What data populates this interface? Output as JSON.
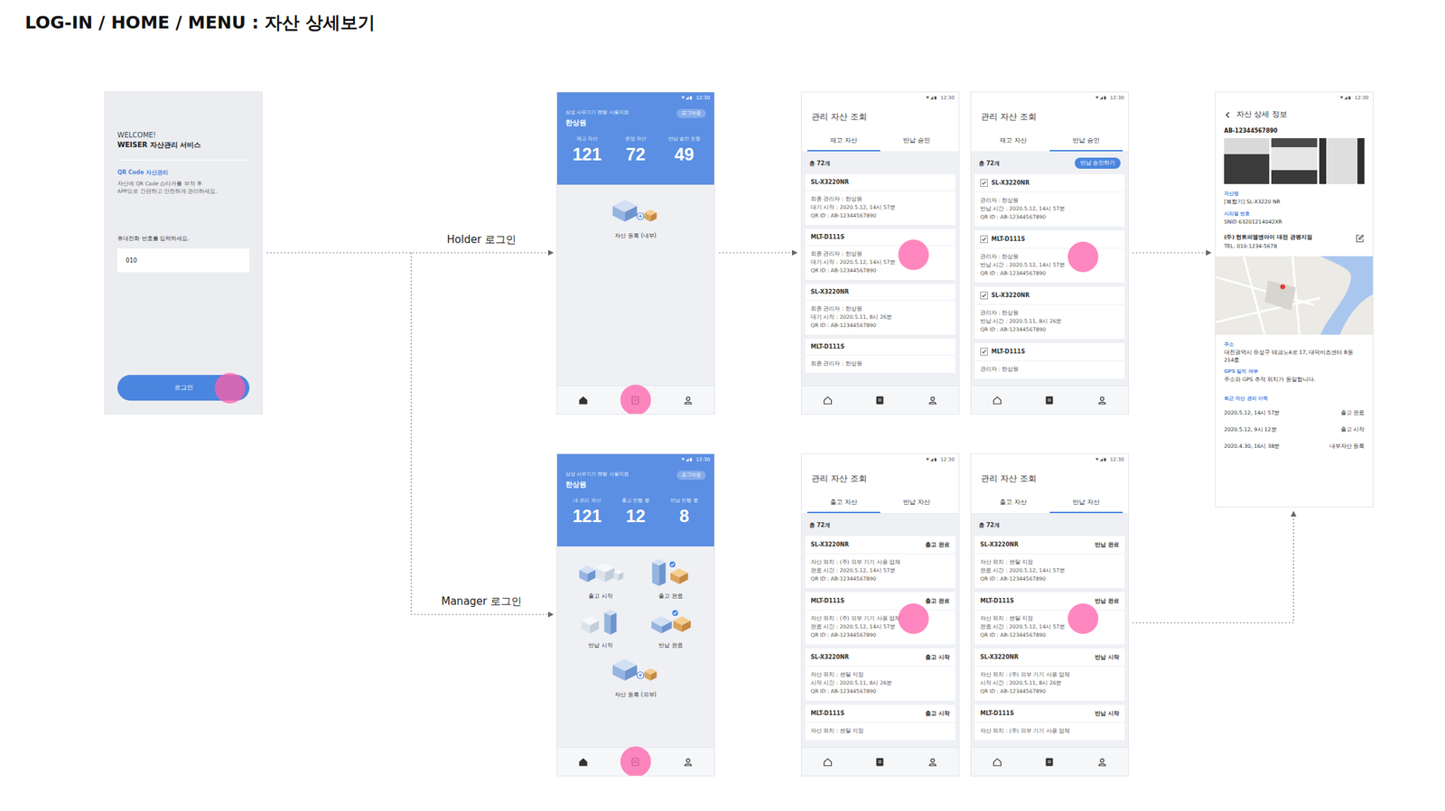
{
  "title": "LOG-IN / HOME / MENU : 자산 상세보기",
  "flow_labels": {
    "holder": "Holder 로그인",
    "manager": "Manager 로그인"
  },
  "login": {
    "welcome": "WELCOME!",
    "service": "WEISER 자산관리 서비스",
    "qr_title": "QR Code 자산관리",
    "qr_desc": [
      "자산에 QR Code 스티커를 부착 후",
      "APP으로 간편하고 안전하게 관리하세요."
    ],
    "phone_label": "휴대전화 번호를 입력하세요.",
    "phone_value": "010",
    "button": "로그인",
    "button_touched": true
  },
  "holder_home": {
    "time": "12:30",
    "branch": "삼성 사무기기 렌탈 서울지점",
    "user": "한상원",
    "logout": "로그아웃",
    "stats": [
      {
        "label": "재고 자산",
        "value": "121"
      },
      {
        "label": "운영 자산",
        "value": "72"
      },
      {
        "label": "반납 승인 요청",
        "value": "49"
      }
    ],
    "menu": [
      {
        "label": "자산 등록 (내부)",
        "kind": "register"
      }
    ],
    "nav": [
      {
        "kind": "home",
        "selected": true,
        "touched": false
      },
      {
        "kind": "list",
        "selected": false,
        "touched": true
      },
      {
        "kind": "person",
        "selected": false,
        "touched": false
      }
    ]
  },
  "manager_home": {
    "time": "12:30",
    "branch": "삼성 사무기기 렌탈 서울지점",
    "user": "한상원",
    "logout": "로그아웃",
    "stats": [
      {
        "label": "내 관리 자산",
        "value": "121"
      },
      {
        "label": "출고 진행 중",
        "value": "12"
      },
      {
        "label": "반납 진행 중",
        "value": "8"
      }
    ],
    "menu": [
      {
        "label": "출고 시작",
        "kind": "out_start"
      },
      {
        "label": "출고 완료",
        "kind": "out_done"
      },
      {
        "label": "반납 시작",
        "kind": "return_start"
      },
      {
        "label": "반납 완료",
        "kind": "return_done"
      },
      {
        "label": "자산 등록 (외부)",
        "kind": "register"
      }
    ],
    "nav": [
      {
        "kind": "home",
        "selected": true,
        "touched": false
      },
      {
        "kind": "list",
        "selected": false,
        "touched": true
      },
      {
        "kind": "person",
        "selected": false,
        "touched": false
      }
    ]
  },
  "holder_stock": {
    "time": "12:30",
    "title": "관리 자산 조회",
    "tabs": [
      {
        "label": "재고 자산",
        "selected": true
      },
      {
        "label": "반납 승인",
        "selected": false
      }
    ],
    "total": "총 72개",
    "cards": [
      {
        "name": "SL-X3220NR",
        "touched": false,
        "lines": [
          "최종 관리자 : 한상원",
          "대기 시작 : 2020.5.12, 14시 57분",
          "QR ID : AB-12344567890"
        ]
      },
      {
        "name": "MLT-D111S",
        "touched": true,
        "lines": [
          "최종 관리자 : 한상원",
          "대기 시작 : 2020.5.12, 14시 57분",
          "QR ID : AB-12344567890"
        ]
      },
      {
        "name": "SL-X3220NR",
        "touched": false,
        "lines": [
          "최종 관리자 : 한상원",
          "대기 시작 : 2020.5.11, 8시 26분",
          "QR ID : AB-12344567890"
        ]
      },
      {
        "name": "MLT-D111S",
        "touched": false,
        "lines": [
          "최종 관리자 : 한상원"
        ]
      }
    ],
    "nav": [
      {
        "kind": "home",
        "selected": false,
        "touched": false
      },
      {
        "kind": "list",
        "selected": true,
        "touched": false
      },
      {
        "kind": "person",
        "selected": false,
        "touched": false
      }
    ]
  },
  "holder_return": {
    "time": "12:30",
    "title": "관리 자산 조회",
    "tabs": [
      {
        "label": "재고 자산",
        "selected": false
      },
      {
        "label": "반납 승인",
        "selected": true
      }
    ],
    "total": "총 72개",
    "action": "반납 승인하기",
    "cards": [
      {
        "name": "SL-X3220NR",
        "checked": true,
        "touched": false,
        "lines": [
          "관리자 : 한상원",
          "반납 시간 : 2020.5.12, 14시 57분",
          "QR ID : AB-12344567890"
        ]
      },
      {
        "name": "MLT-D111S",
        "checked": true,
        "touched": true,
        "lines": [
          "관리자 : 한상원",
          "반납 시간 : 2020.5.12, 14시 57분",
          "QR ID : AB-12344567890"
        ]
      },
      {
        "name": "SL-X3220NR",
        "checked": true,
        "touched": false,
        "lines": [
          "관리자 : 한상원",
          "반납 시간 : 2020.5.11, 8시 26분",
          "QR ID : AB-12344567890"
        ]
      },
      {
        "name": "MLT-D111S",
        "checked": true,
        "touched": false,
        "lines": [
          "관리자 : 한상원"
        ]
      }
    ],
    "nav": [
      {
        "kind": "home",
        "selected": false,
        "touched": false
      },
      {
        "kind": "list",
        "selected": true,
        "touched": false
      },
      {
        "kind": "person",
        "selected": false,
        "touched": false
      }
    ]
  },
  "manager_out": {
    "time": "12:30",
    "title": "관리 자산 조회",
    "tabs": [
      {
        "label": "출고 자산",
        "selected": true
      },
      {
        "label": "반납 자산",
        "selected": false
      }
    ],
    "total": "총 72개",
    "cards": [
      {
        "name": "SL-X3220NR",
        "status": "출고 완료",
        "touched": false,
        "lines": [
          "자산 위치 : (주) 외부 기기 사용 업체",
          "완료 시간 : 2020.5.12, 14시 57분",
          "QR ID : AB-12344567890"
        ]
      },
      {
        "name": "MLT-D111S",
        "status": "출고 완료",
        "touched": true,
        "lines": [
          "자산 위치 : (주) 외부 기기 사용 업체",
          "완료 시간 : 2020.5.12, 14시 57분",
          "QR ID : AB-12344567890"
        ]
      },
      {
        "name": "SL-X3220NR",
        "status": "출고 시작",
        "touched": false,
        "lines": [
          "자산 위치 : 렌탈 지점",
          "시작 시간 : 2020.5.11, 8시 26분",
          "QR ID : AB-12344567890"
        ]
      },
      {
        "name": "MLT-D111S",
        "status": "출고 시작",
        "touched": false,
        "lines": [
          "자산 위치 : 렌탈 지점"
        ]
      }
    ],
    "nav": [
      {
        "kind": "home",
        "selected": false,
        "touched": false
      },
      {
        "kind": "list",
        "selected": true,
        "touched": false
      },
      {
        "kind": "person",
        "selected": false,
        "touched": false
      }
    ]
  },
  "manager_return": {
    "time": "12:30",
    "title": "관리 자산 조회",
    "tabs": [
      {
        "label": "출고 자산",
        "selected": false
      },
      {
        "label": "반납 자산",
        "selected": true
      }
    ],
    "total": "총 72개",
    "cards": [
      {
        "name": "SL-X3220NR",
        "status": "반납 완료",
        "touched": false,
        "lines": [
          "자산 위치 : 렌탈 지점",
          "완료 시간 : 2020.5.12, 14시 57분",
          "QR ID : AB-12344567890"
        ]
      },
      {
        "name": "MLT-D111S",
        "status": "반납 완료",
        "touched": true,
        "lines": [
          "자산 위치 : 렌탈 지점",
          "완료 시간 : 2020.5.12, 14시 57분",
          "QR ID : AB-12344567890"
        ]
      },
      {
        "name": "SL-X3220NR",
        "status": "반납 시작",
        "touched": false,
        "lines": [
          "자산 위치 : (주) 외부 기기 사용 업체",
          "시작 시간 : 2020.5.11, 8시 26분",
          "QR ID : AB-12344567890"
        ]
      },
      {
        "name": "MLT-D111S",
        "status": "반납 시작",
        "touched": false,
        "lines": [
          "자산 위치 : (주) 외부 기기 사용 업체"
        ]
      }
    ],
    "nav": [
      {
        "kind": "home",
        "selected": false,
        "touched": false
      },
      {
        "kind": "list",
        "selected": true,
        "touched": false
      },
      {
        "kind": "person",
        "selected": false,
        "touched": false
      }
    ]
  },
  "detail": {
    "time": "12:30",
    "title": "자산 상세 정보",
    "qr_id": "AB-12344567890",
    "fields": [
      {
        "label": "자산명",
        "value": "[복합기] SL-X3220 NR"
      },
      {
        "label": "시리얼 번호",
        "value": "SNID 63201214042XR"
      }
    ],
    "company": "(주) 헌트피엠앤아이 대전 관평지점",
    "tel": "TEL. 010-1234-5678",
    "location_fields": [
      {
        "label": "주소",
        "value": "대전광역시 유성구 테크노4로 17, 대덕비즈센터 B동 214호"
      },
      {
        "label": "GPS 일치 여부",
        "value": "주소와 GPS 추적 위치가 동일합니다."
      }
    ],
    "history_title": "최근 자산 관리 이력",
    "history": [
      {
        "time": "2020.5.12, 14시 57분",
        "event": "출고 완료"
      },
      {
        "time": "2020.5.12, 9시 12분",
        "event": "출고 시작"
      },
      {
        "time": "2020.4.30, 16시 38분",
        "event": "내부자산 등록"
      }
    ]
  }
}
